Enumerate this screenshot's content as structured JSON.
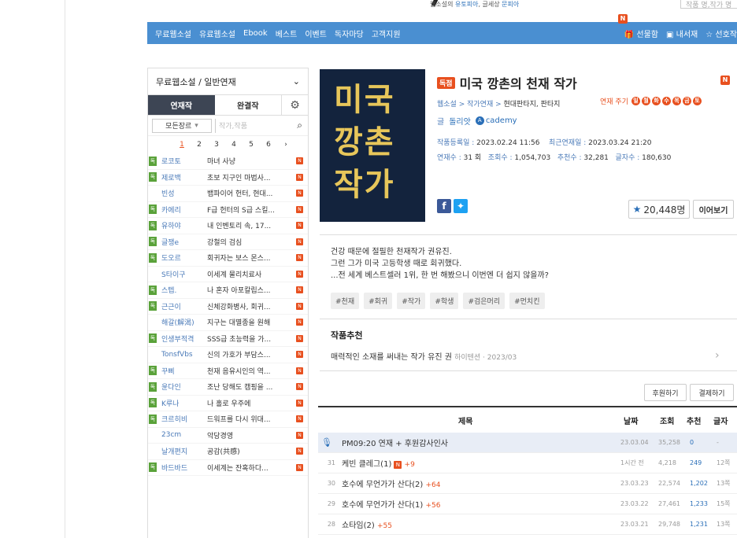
{
  "header": {
    "tagline_prefix": "웹소설의 ",
    "tagline_a": "유토피아",
    "tagline_mid": ", 글세상 ",
    "tagline_b": "문피아",
    "search_placeholder": "작품 명,작가 명"
  },
  "nav": {
    "items": [
      "무료웹소설",
      "유료웹소설",
      "Ebook",
      "베스트",
      "이벤트",
      "독자마당",
      "고객지원"
    ],
    "badge": "N",
    "gift": "선물함",
    "library": "내서재",
    "favorites": "선호작"
  },
  "sidebar": {
    "dropdown": "무료웹소설 / 일반연재",
    "tabs": [
      "연재작",
      "완결작"
    ],
    "genre_select": "모든장르",
    "search_placeholder": "작가,작품",
    "pages": [
      "1",
      "2",
      "3",
      "4",
      "5",
      "6",
      "›"
    ],
    "dok_label": "독",
    "n_label": "N",
    "rows": [
      {
        "dok": true,
        "author": "로코토",
        "title": "마녀 사냥"
      },
      {
        "dok": true,
        "author": "제로백",
        "title": "초보 지구인 마법사..."
      },
      {
        "dok": false,
        "author": "빈성",
        "title": "뱀파이어 헌터, 현대..."
      },
      {
        "dok": true,
        "author": "카에리",
        "title": "F급 헌터의 S급 스킬..."
      },
      {
        "dok": true,
        "author": "유하야",
        "title": "내 인벤토리 속, 17..."
      },
      {
        "dok": true,
        "author": "글쟁e",
        "title": "강철의 검심"
      },
      {
        "dok": true,
        "author": "도오르",
        "title": "회귀자는 보스 몬스..."
      },
      {
        "dok": false,
        "author": "S타이구",
        "title": "이세계 물리치료사"
      },
      {
        "dok": true,
        "author": "스텝.",
        "title": "나 혼자 아포칼립스..."
      },
      {
        "dok": true,
        "author": "근근이",
        "title": "신체강화병사, 회귀..."
      },
      {
        "dok": false,
        "author": "해갈(解渴)",
        "title": "지구는 대멸종을 원해"
      },
      {
        "dok": true,
        "author": "인생부적격",
        "title": "SSS급 초능력을 가..."
      },
      {
        "dok": false,
        "author": "TonsfVbs",
        "title": "신의 가호가 부담스..."
      },
      {
        "dok": true,
        "author": "꾸삐",
        "title": "천재 음유시인의 역..."
      },
      {
        "dok": true,
        "author": "윤다인",
        "title": "조난 당해도 캠핑을 ..."
      },
      {
        "dok": true,
        "author": "K루나",
        "title": "나 홀로 우주에"
      },
      {
        "dok": true,
        "author": "크르히비",
        "title": "드워프를 다시 위대..."
      },
      {
        "dok": false,
        "author": "23cm",
        "title": "악당경영"
      },
      {
        "dok": false,
        "author": "날개편지",
        "title": "공감(共感)"
      },
      {
        "dok": true,
        "author": "바드바드",
        "title": "이세계는 잔혹하다..."
      }
    ]
  },
  "book": {
    "cover_text": [
      "미국",
      "깡촌",
      "작가"
    ],
    "exclusive_badge": "독점",
    "title": "미국 깡촌의 천재 작가",
    "n_badge": "N",
    "genre_prefix": "웹소설 > 작가연재 > ",
    "genre_value": "현대판타지, 판타지",
    "cycle_label": "연재 주기",
    "cycle_days": [
      "일",
      "월",
      "화",
      "수",
      "목",
      "금",
      "토"
    ],
    "author_label": "글",
    "author": "돌리앗",
    "academy": "cademy",
    "registered_label": "작품등록일 :",
    "registered": "2023.02.24 11:56",
    "latest_label": "최근연재일 :",
    "latest": "2023.03.24 21:20",
    "episodes_label": "연재수 :",
    "episodes": "31 회",
    "views_label": "조회수 :",
    "views": "1,054,703",
    "recs_label": "추천수 :",
    "recs": "32,281",
    "chars_label": "글자수 :",
    "chars": "180,630",
    "fav_count": "20,448명",
    "continue": "이어보기",
    "synopsis": [
      "건강 때문에 절필한 천재작가 권유진.",
      "그런 그가 미국 고등학생 때로 회귀했다.",
      "...전 세계 베스트셀러 1위, 한 번 해봤으니 이번엔 더 쉽지 않을까?"
    ],
    "tags": [
      "#천재",
      "#회귀",
      "#작가",
      "#학생",
      "#검은머리",
      "#먼치킨"
    ]
  },
  "recommend": {
    "heading": "작품추천",
    "item": "매력적인 소재를 써내는 작가 유진 권",
    "item_sub": "하이텐션 · 2023/03"
  },
  "buttons": {
    "support": "후원하기",
    "pay": "결제하기"
  },
  "episodes_table": {
    "headers": {
      "title": "제목",
      "date": "날짜",
      "views": "조회",
      "recs": "추천",
      "chars": "글자"
    },
    "rows": [
      {
        "notice": true,
        "num": "",
        "title": "PM09:20 연재 + 후원감사인사",
        "new": false,
        "plus": "",
        "date": "23.03.04",
        "views": "35,258",
        "recs": "0",
        "chars": "-"
      },
      {
        "notice": false,
        "num": "31",
        "title": "케빈 클레그(1)",
        "new": true,
        "plus": "+9",
        "date": "1시간 전",
        "views": "4,218",
        "recs": "249",
        "chars": "12쪽"
      },
      {
        "notice": false,
        "num": "30",
        "title": "호수에 무언가가 산다(2)",
        "new": false,
        "plus": "+64",
        "date": "23.03.23",
        "views": "22,574",
        "recs": "1,202",
        "chars": "13쪽"
      },
      {
        "notice": false,
        "num": "29",
        "title": "호수에 무언가가 산다(1)",
        "new": false,
        "plus": "+56",
        "date": "23.03.22",
        "views": "27,461",
        "recs": "1,233",
        "chars": "15쪽"
      },
      {
        "notice": false,
        "num": "28",
        "title": "쇼타임(2)",
        "new": false,
        "plus": "+55",
        "date": "23.03.21",
        "views": "29,748",
        "recs": "1,231",
        "chars": "13쪽"
      }
    ]
  }
}
